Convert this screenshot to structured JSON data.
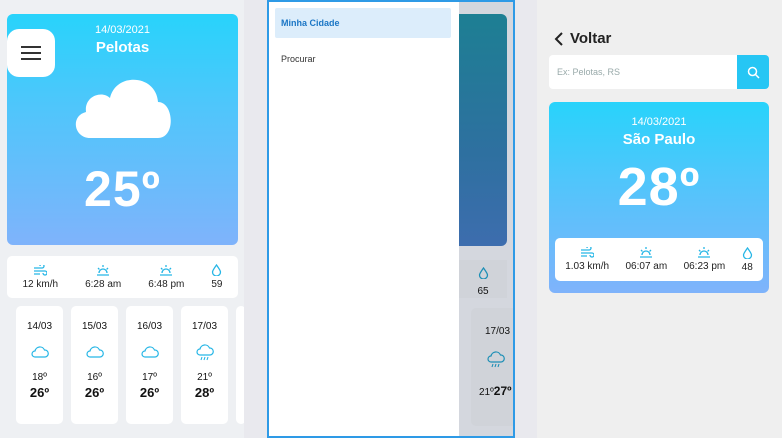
{
  "screen_home": {
    "date": "14/03/2021",
    "city": "Pelotas",
    "temp": "25º",
    "icon": "cloud-icon",
    "stats": [
      {
        "icon": "wind-icon",
        "value": "12 km/h"
      },
      {
        "icon": "sunrise-icon",
        "value": "6:28 am"
      },
      {
        "icon": "sunset-icon",
        "value": "6:48 pm"
      },
      {
        "icon": "humidity-icon",
        "value": "59"
      }
    ],
    "forecast": [
      {
        "date": "14/03",
        "icon": "cloud-icon",
        "min": "18º",
        "max": "26º"
      },
      {
        "date": "15/03",
        "icon": "cloud-icon",
        "min": "16º",
        "max": "26º"
      },
      {
        "date": "16/03",
        "icon": "cloud-icon",
        "min": "17º",
        "max": "26º"
      },
      {
        "date": "17/03",
        "icon": "rain-cloud-icon",
        "min": "21º",
        "max": "28º"
      }
    ]
  },
  "drawer": {
    "items": [
      {
        "label": "Minha Cidade",
        "active": true
      },
      {
        "label": "Procurar",
        "active": false
      }
    ],
    "background_humidity": "65",
    "background_day": {
      "date": "17/03",
      "min": "21º",
      "max": "27º"
    }
  },
  "screen_search": {
    "back_label": "Voltar",
    "search_placeholder": "Ex: Pelotas, RS",
    "date": "14/03/2021",
    "city": "São Paulo",
    "temp": "28º",
    "stats": [
      {
        "icon": "wind-icon",
        "value": "1.03 km/h"
      },
      {
        "icon": "sunrise-icon",
        "value": "06:07 am"
      },
      {
        "icon": "sunset-icon",
        "value": "06:23 pm"
      },
      {
        "icon": "humidity-icon",
        "value": "48"
      }
    ]
  },
  "colors": {
    "accent": "#26c6f4",
    "active_item": "#1b76c5",
    "drawer_border": "#2e9ae6"
  }
}
